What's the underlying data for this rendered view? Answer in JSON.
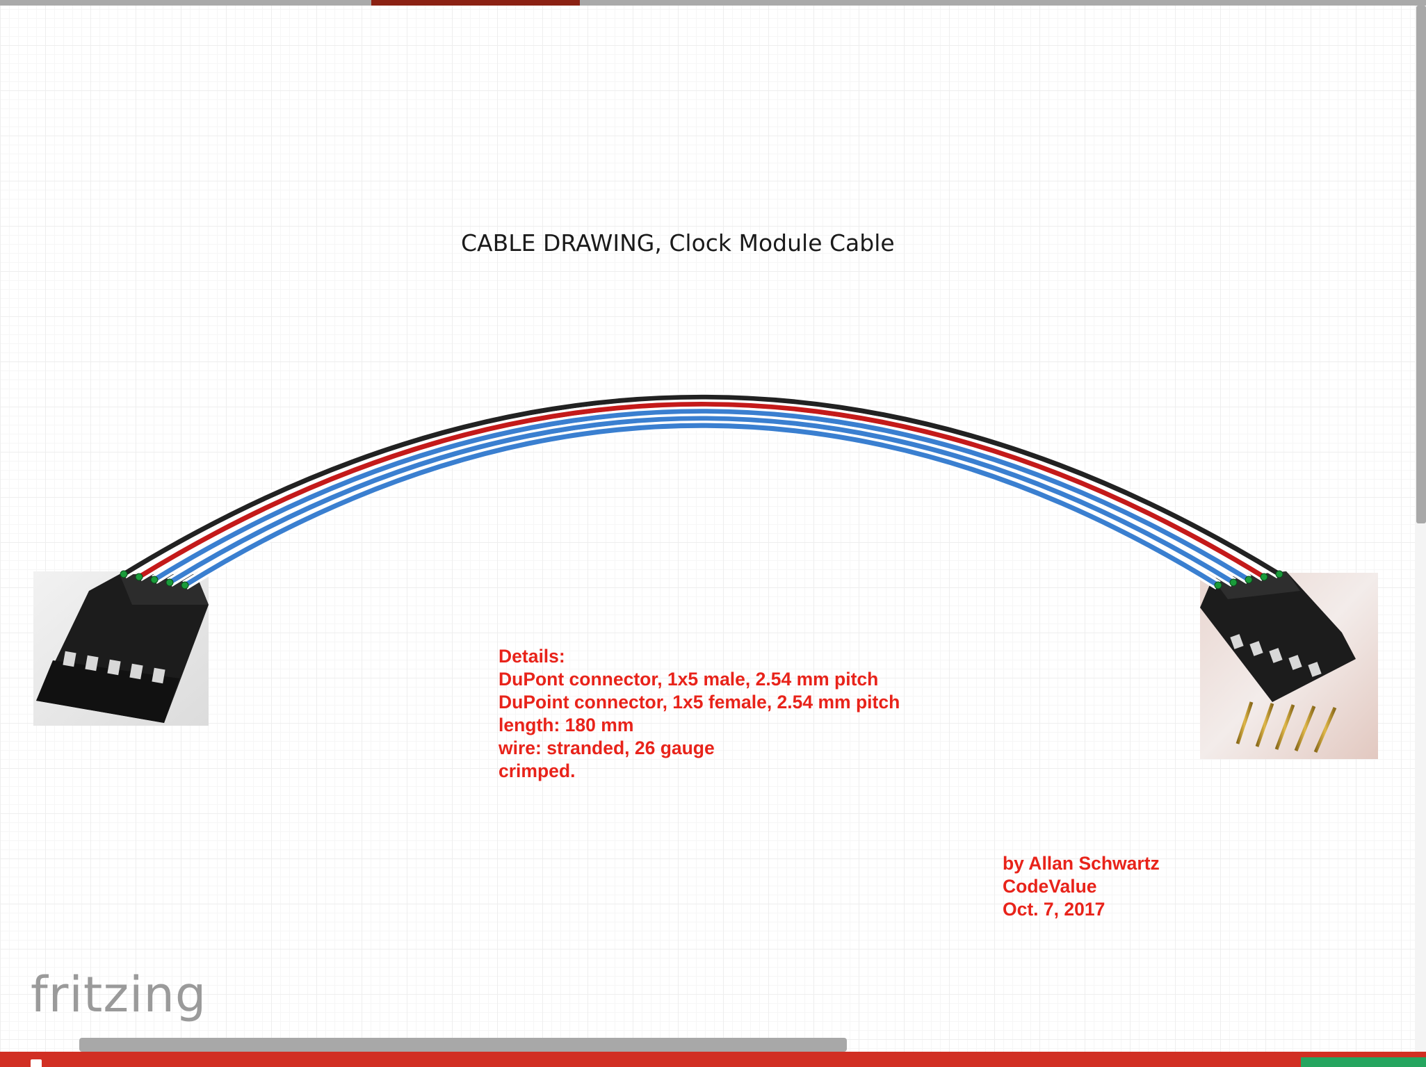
{
  "title": "CABLE DRAWING, Clock Module Cable",
  "details": {
    "lines": [
      "Details:",
      "DuPont connector, 1x5 male, 2.54 mm pitch",
      "DuPoint connector, 1x5 female, 2.54 mm pitch",
      "length: 180 mm",
      "wire: stranded, 26 gauge",
      "crimped."
    ]
  },
  "credits": {
    "lines": [
      "by Allan Schwartz",
      "CodeValue",
      "Oct. 7, 2017"
    ]
  },
  "logo": {
    "text": "fritzing"
  },
  "colors": {
    "wire_black": "#222222",
    "wire_red": "#c41a1a",
    "wire_blue": "#3a7fd0",
    "annotation": "#e8231a",
    "accent_bar": "#d12f23",
    "tab_active": "#8b2113"
  },
  "wires": [
    {
      "color": "black"
    },
    {
      "color": "red"
    },
    {
      "color": "blue"
    },
    {
      "color": "blue"
    },
    {
      "color": "blue"
    }
  ],
  "connectors": {
    "left": {
      "type": "female",
      "pins": 5
    },
    "right": {
      "type": "male",
      "pins": 5
    }
  }
}
